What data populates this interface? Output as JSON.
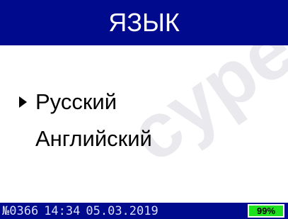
{
  "header": {
    "title": "ЯЗЫК"
  },
  "menu": {
    "items": [
      {
        "label": "Русский",
        "selected": true
      },
      {
        "label": "Английский",
        "selected": false
      }
    ]
  },
  "status": {
    "device_number": "№0366",
    "time": "14:34",
    "date": "05.03.2019",
    "battery": "99%",
    "battery_fraction": 0.99
  },
  "watermark": "cyper",
  "colors": {
    "header_bg": "#000a8c",
    "status_bg": "#000a8c",
    "battery_fill": "#1ee01e",
    "text": "#000000"
  },
  "icons": {
    "cursor": "triangle-right-icon"
  }
}
